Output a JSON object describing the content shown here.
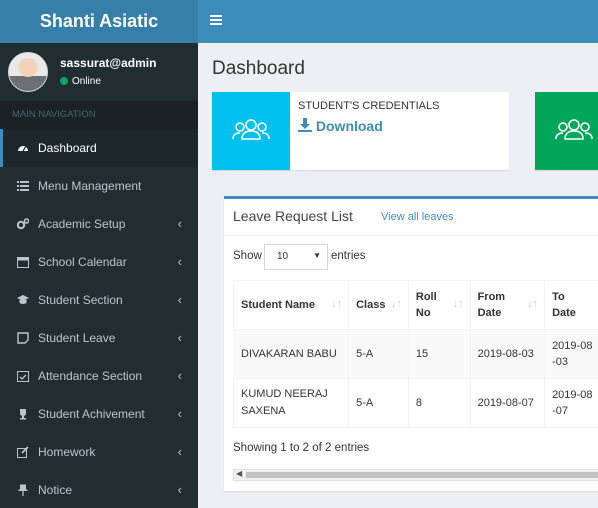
{
  "app": {
    "brand": "Shanti Asiatic"
  },
  "user": {
    "name": "sassurat@admin",
    "status": "Online"
  },
  "sidebar": {
    "header": "MAIN NAVIGATION",
    "items": [
      {
        "label": "Dashboard",
        "icon": "dashboard-icon",
        "active": true
      },
      {
        "label": "Menu Management",
        "icon": "list-icon"
      },
      {
        "label": "Academic Setup",
        "icon": "cogs-icon"
      },
      {
        "label": "School Calendar",
        "icon": "calendar-icon"
      },
      {
        "label": "Student Section",
        "icon": "graduation-cap-icon"
      },
      {
        "label": "Student Leave",
        "icon": "note-icon"
      },
      {
        "label": "Attendance Section",
        "icon": "calendar-check-icon"
      },
      {
        "label": "Student Achivement",
        "icon": "trophy-icon"
      },
      {
        "label": "Homework",
        "icon": "edit-icon"
      },
      {
        "label": "Notice",
        "icon": "pin-icon"
      }
    ],
    "chevron": "‹"
  },
  "page": {
    "title": "Dashboard"
  },
  "infoboxes": [
    {
      "title": "STUDENT'S CREDENTIALS",
      "link": "Download",
      "color": "#00c0ef"
    },
    {
      "color": "#00a65a"
    }
  ],
  "leave_box": {
    "title": "Leave Request List",
    "link": "View all leaves",
    "show_label": "Show",
    "entries_label": "entries",
    "page_size": "10",
    "columns": [
      "Student Name",
      "Class",
      "Roll No",
      "From Date",
      "To Date"
    ],
    "rows": [
      [
        "DIVAKARAN BABU",
        "5-A",
        "15",
        "2019-08-03",
        "2019-08-03"
      ],
      [
        "KUMUD NEERAJ SAXENA",
        "5-A",
        "8",
        "2019-08-07",
        "2019-08-07"
      ]
    ],
    "info": "Showing 1 to 2 of 2 entries"
  },
  "colors": {
    "header": "#3c8dbc",
    "logo": "#367fa9",
    "sidebar": "#222d32",
    "accent": "#3c8dbc"
  }
}
